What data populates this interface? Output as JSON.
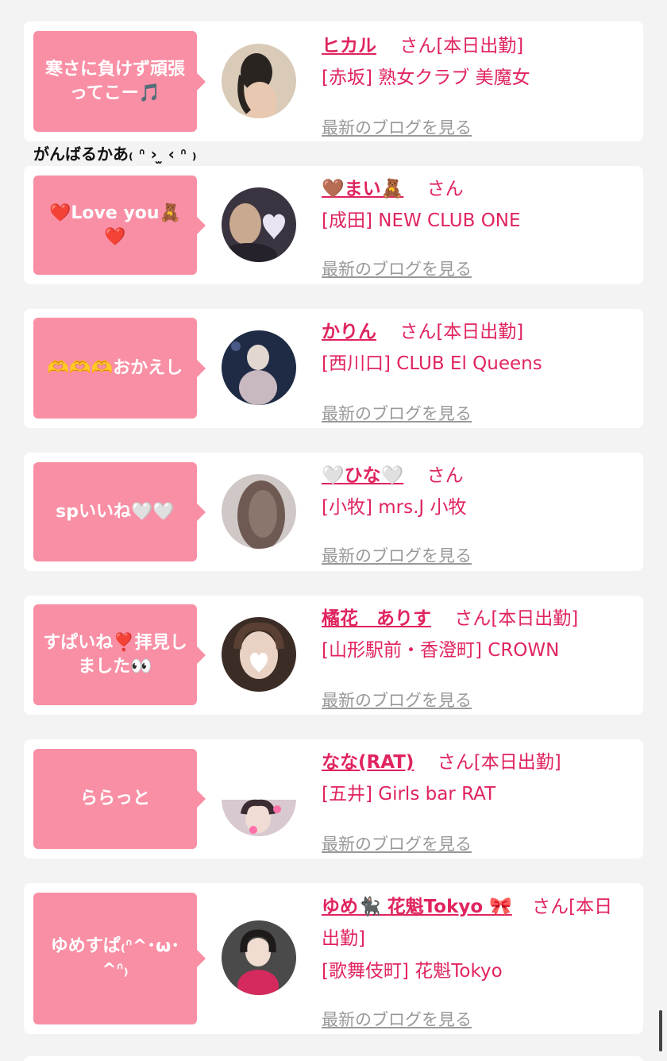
{
  "cards": [
    {
      "comment": "寒さに負けず頑張ってこー🎵",
      "name": "ヒカル",
      "honorific": "さん",
      "status": "[本日出勤]",
      "shop": "[赤坂] 熟女クラブ 美魔女",
      "blog_link": "最新のブログを見る"
    },
    {
      "comment": "❤️Love you🧸❤️",
      "name": "🤎まい🧸",
      "honorific": "さん",
      "status": "",
      "shop": "[成田] NEW CLUB ONE",
      "blog_link": "最新のブログを見る"
    },
    {
      "comment": "🫶🫶🫶おかえし",
      "name": "かりん",
      "honorific": "さん",
      "status": "[本日出勤]",
      "shop": "[西川口] CLUB El Queens",
      "blog_link": "最新のブログを見る"
    },
    {
      "comment": "spいいね🤍🤍",
      "name": "🤍ひな🤍",
      "honorific": "さん",
      "status": "",
      "shop": "[小牧] mrs.J 小牧",
      "blog_link": "最新のブログを見る"
    },
    {
      "comment": "すぱいね❣️拝見しました👀",
      "name": "橘花　ありす",
      "honorific": "さん",
      "status": "[本日出勤]",
      "shop": "[山形駅前・香澄町] CROWN",
      "blog_link": "最新のブログを見る"
    },
    {
      "comment": "ららっと",
      "name": "なな(RAT)",
      "honorific": "さん",
      "status": "[本日出勤]",
      "shop": "[五井] Girls bar RAT",
      "blog_link": "最新のブログを見る"
    },
    {
      "comment": "ゆめすぱ₍ᐢ^･ω･^ᐢ₎",
      "name": "ゆめ🐈‍⬛ 花魁Tokyo 🎀",
      "honorific": "さん",
      "status": "[本日出勤]",
      "shop": "[歌舞伎町] 花魁Tokyo",
      "blog_link": "最新のブログを見る"
    }
  ],
  "extra_caption": "がんばるかあ₍ ᐢ › ̫ ‹ ᐢ ₎",
  "colors": {
    "bubble": "#f98fa5",
    "accent": "#e0245e",
    "link_gray": "#999999",
    "page_bg": "#f3f3f3"
  }
}
